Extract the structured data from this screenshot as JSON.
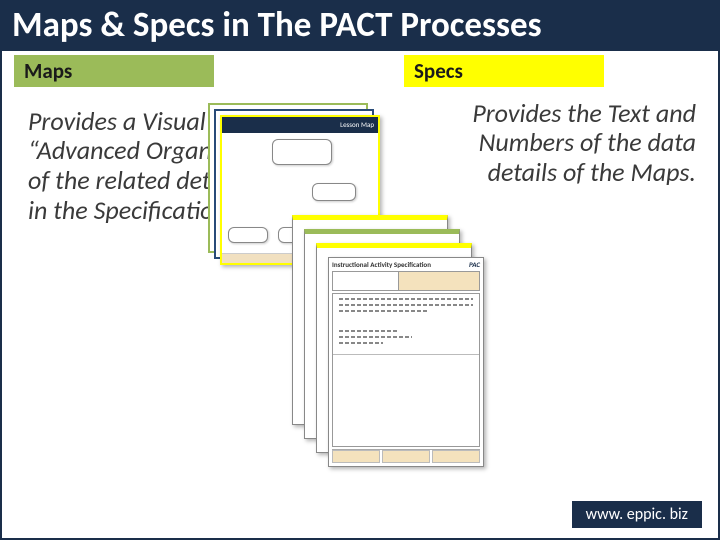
{
  "title": "Maps & Specs in The PACT Processes",
  "tags": {
    "maps": "Maps",
    "specs": "Specs"
  },
  "maps_desc": "Provides a Visual “Advanced Organizer” of the related details in the Specifications.",
  "specs_desc": "Provides the Text and Numbers of the data details of the Maps.",
  "map_thumb": {
    "header_right": "Lesson Map"
  },
  "spec_thumb": {
    "header_left": "Instructional Activity Specification",
    "header_right": "PAC"
  },
  "footer": "www. eppic. biz"
}
